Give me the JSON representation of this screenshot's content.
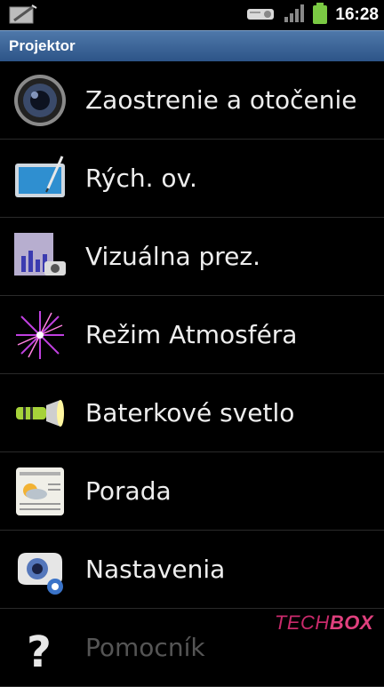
{
  "status_bar": {
    "time": "16:28"
  },
  "title_bar": {
    "title": "Projektor"
  },
  "menu": {
    "items": [
      {
        "label": "Zaostrenie a otočenie",
        "icon": "camera-lens-icon"
      },
      {
        "label": "Rých. ov.",
        "icon": "quick-pad-icon"
      },
      {
        "label": "Vizuálna prez.",
        "icon": "visual-presenter-icon"
      },
      {
        "label": "Režim Atmosféra",
        "icon": "firework-icon"
      },
      {
        "label": "Baterkové svetlo",
        "icon": "flashlight-icon"
      },
      {
        "label": "Porada",
        "icon": "meeting-icon"
      },
      {
        "label": "Nastavenia",
        "icon": "projector-settings-icon"
      },
      {
        "label": "Pomocník",
        "icon": "help-icon"
      }
    ]
  },
  "watermark": {
    "part1": "TECH",
    "part2": "BOX"
  }
}
